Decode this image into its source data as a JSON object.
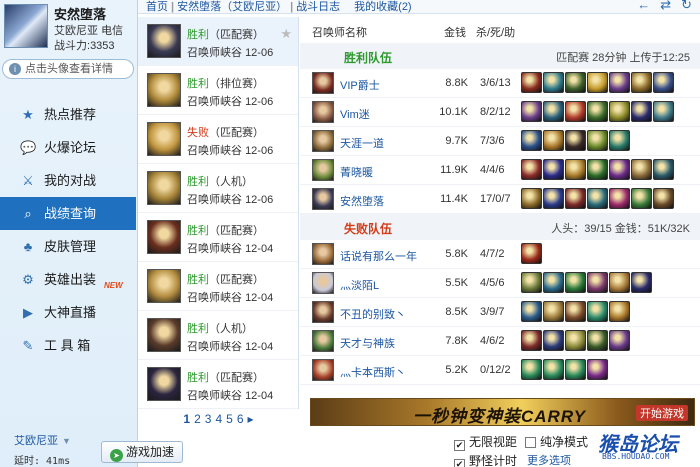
{
  "profile": {
    "name": "安然堕落",
    "server": "艾欧尼亚",
    "server_tag": "电信",
    "power_label": "战斗力:",
    "power_value": "3353",
    "details_link": "点击头像查看详情"
  },
  "nav": [
    {
      "label": "热点推荐",
      "icon": "star-icon",
      "glyph": "★"
    },
    {
      "label": "火爆论坛",
      "icon": "chat-icon",
      "glyph": "💬"
    },
    {
      "label": "我的对战",
      "icon": "battle-icon",
      "glyph": "⚔"
    },
    {
      "label": "战绩查询",
      "icon": "search-icon",
      "glyph": "⌕"
    },
    {
      "label": "皮肤管理",
      "icon": "skin-icon",
      "glyph": "♣"
    },
    {
      "label": "英雄出装",
      "icon": "gear-icon",
      "glyph": "⚙",
      "badge": "NEW"
    },
    {
      "label": "大神直播",
      "icon": "live-icon",
      "glyph": "▶"
    },
    {
      "label": "工 具 箱",
      "icon": "wrench-icon",
      "glyph": "✎"
    }
  ],
  "footer": {
    "region": "艾欧尼亚",
    "latency": "延时: 41ms",
    "accel_button": "游戏加速",
    "opt_unlimited_view": "无限视距",
    "opt_pure_mode": "纯净模式",
    "opt_jungle_timer": "野怪计时",
    "more_options": "更多选项",
    "logo_text": "猴岛论坛",
    "logo_url": "BBS.HOUDAO.COM"
  },
  "breadcrumb": {
    "home": "首页",
    "user": "安然堕落（艾欧尼亚）",
    "page": "战斗日志",
    "favorites": "我的收藏(2)"
  },
  "matches": [
    {
      "result": "胜利",
      "outcome": "win",
      "mode": "（匹配赛）",
      "map": "召唤师峡谷",
      "date": "12-06",
      "color": "#3a3a55"
    },
    {
      "result": "胜利",
      "outcome": "win",
      "mode": "（排位赛）",
      "map": "召唤师峡谷",
      "date": "12-06",
      "color": "#b08a3a"
    },
    {
      "result": "失败",
      "outcome": "lose",
      "mode": "（匹配赛）",
      "map": "召唤师峡谷",
      "date": "12-06",
      "color": "#c2963f"
    },
    {
      "result": "胜利",
      "outcome": "win",
      "mode": "（人机）",
      "map": "召唤师峡谷",
      "date": "12-06",
      "color": "#a9873a"
    },
    {
      "result": "胜利",
      "outcome": "win",
      "mode": "（匹配赛）",
      "map": "召唤师峡谷",
      "date": "12-04",
      "color": "#6b2f1e"
    },
    {
      "result": "胜利",
      "outcome": "win",
      "mode": "（匹配赛）",
      "map": "召唤师峡谷",
      "date": "12-04",
      "color": "#b48d40"
    },
    {
      "result": "胜利",
      "outcome": "win",
      "mode": "（人机）",
      "map": "召唤师峡谷",
      "date": "12-04",
      "color": "#5a3b2b"
    },
    {
      "result": "胜利",
      "outcome": "win",
      "mode": "（匹配赛）",
      "map": "召唤师峡谷",
      "date": "12-04",
      "color": "#2b2540"
    }
  ],
  "pager": [
    "1",
    "2",
    "3",
    "4",
    "5",
    "6",
    "▸"
  ],
  "detail": {
    "col_name": "召唤师名称",
    "col_gold": "金钱",
    "col_kda": "杀/死/助",
    "win_title": "胜利队伍",
    "win_info": "匹配赛 28分钟 上传于12:25",
    "lose_title": "失败队伍",
    "lose_info": "人头：39/15 金钱：51K/32K",
    "win_players": [
      {
        "name": "VIP爵士",
        "gold": "8.8K",
        "kda": "3/6/13",
        "pic": "#7a2a1f",
        "items": [
          "#8a2c1f",
          "#2f7a8a",
          "#3d5f2a",
          "#c49a2a",
          "#6a3d8a",
          "#8a6a2a",
          "#3a4f8a"
        ]
      },
      {
        "name": "Vim迷",
        "gold": "10.1K",
        "kda": "8/2/12",
        "pic": "#8a5a44",
        "items": [
          "#6a3d8a",
          "#2a5f7a",
          "#b03a2a",
          "#3a6a2a",
          "#8a8a2a",
          "#2a2a6a",
          "#3f7a8a"
        ]
      },
      {
        "name": "天涯一道",
        "gold": "9.7K",
        "kda": "7/3/6",
        "pic": "#8a6a3a",
        "items": [
          "#2a4f8a",
          "#a8762a",
          "#3a2a2a",
          "#6a8a2a",
          "#2a7a6a"
        ]
      },
      {
        "name": "菁晓暖",
        "gold": "11.9K",
        "kda": "4/4/6",
        "pic": "#6a8a3a",
        "items": [
          "#8a2a2a",
          "#2a2a8a",
          "#a87a2a",
          "#2a6a2a",
          "#6a2a8a",
          "#8a6a3a",
          "#2a5a6a"
        ]
      },
      {
        "name": "安然堕落",
        "gold": "11.4K",
        "kda": "17/0/7",
        "pic": "#3a3a55",
        "items": [
          "#8a6a2a",
          "#2a3a8a",
          "#7a2a2a",
          "#2a6a7a",
          "#9a2a6a",
          "#3a7a3a",
          "#6a4a2a"
        ]
      }
    ],
    "lose_players": [
      {
        "name": "话说有那么一年",
        "gold": "5.8K",
        "kda": "4/7/2",
        "pic": "#9a6a3a",
        "items": [
          "#9a2a1a"
        ]
      },
      {
        "name": "灬淡陌L",
        "gold": "5.5K",
        "kda": "4/5/6",
        "pic": "#c9c9d9",
        "items": [
          "#6a7a3a",
          "#2a6a8a",
          "#2a7a3a",
          "#7a3a6a",
          "#a87a3a",
          "#2a2a6a"
        ]
      },
      {
        "name": "不丑的别致丶",
        "gold": "8.5K",
        "kda": "3/9/7",
        "pic": "#6a3a2a",
        "items": [
          "#2a5a8a",
          "#9a7a3a",
          "#7a4a2a",
          "#2a8a6a",
          "#a8762a"
        ]
      },
      {
        "name": "天才与神族",
        "gold": "7.8K",
        "kda": "4/6/2",
        "pic": "#4a7a3a",
        "items": [
          "#7a2a2a",
          "#2a3a7a",
          "#8a8a3a",
          "#3a5a2a",
          "#6a3a8a"
        ]
      },
      {
        "name": "灬卡本西斯丶",
        "gold": "5.2K",
        "kda": "0/12/2",
        "pic": "#a8402a",
        "items": [
          "#2a8a5a",
          "#2a8a5a",
          "#2a8a5a",
          "#7a2a8a"
        ]
      }
    ]
  },
  "banner": {
    "text": "一秒钟变神装CARRY",
    "start": "开始游戏"
  },
  "icons": {
    "back": "←",
    "share": "⇄",
    "refresh": "↻",
    "star": "★",
    "info": "i"
  }
}
